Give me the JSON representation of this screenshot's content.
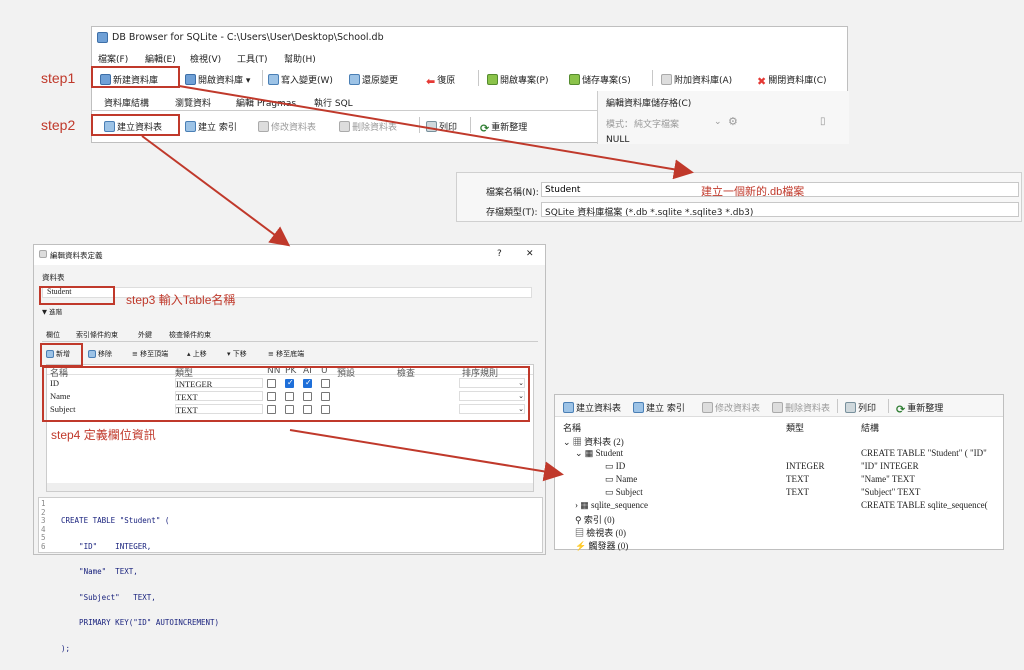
{
  "steps": {
    "step1": "step1",
    "step2": "step2",
    "step3": "step3 輸入Table名稱",
    "step4": "step4  定義欄位資訊"
  },
  "main_window": {
    "title": "DB Browser for SQLite - C:\\Users\\User\\Desktop\\School.db",
    "menu": [
      "檔案(F)",
      "編輯(E)",
      "檢視(V)",
      "工具(T)",
      "幫助(H)"
    ],
    "toolbar": [
      "新建資料庫",
      "開啟資料庫",
      "寫入變更(W)",
      "還原變更",
      "復原",
      "開啟專案(P)",
      "儲存專案(S)",
      "附加資料庫(A)",
      "關閉資料庫(C)"
    ],
    "tabs": [
      "資料庫結構",
      "瀏覽資料",
      "編輯 Pragmas",
      "執行 SQL"
    ],
    "subtoolbar": [
      "建立資料表",
      "建立 索引",
      "修改資料表",
      "刪除資料表",
      "列印",
      "重新整理"
    ],
    "right_panel": {
      "title": "編輯資料庫儲存格(C)",
      "mode_label": "模式：",
      "mode_value": "純文字檔案",
      "null_text": "NULL"
    }
  },
  "save_dialog": {
    "filename_label": "檔案名稱(N):",
    "filename_value": "Student",
    "filetype_label": "存檔類型(T):",
    "filetype_value": "SQLite 資料庫檔案 (*.db *.sqlite *.sqlite3 *.db3)",
    "annotation": "建立一個新的.db檔案"
  },
  "edit_dialog": {
    "title": "編輯資料表定義",
    "help": "?",
    "close": "✕",
    "table_label": "資料表",
    "table_name": "Student",
    "advanced": "▼ 進階",
    "tabs": [
      "欄位",
      "索引條件約束",
      "外鍵",
      "檢查條件約束"
    ],
    "field_toolbar": [
      "新增",
      "移除",
      "移至頂端",
      "上移",
      "下移",
      "移至底端"
    ],
    "columns": [
      "名稱",
      "類型",
      "NN",
      "PK",
      "AI",
      "U",
      "預設",
      "檢查",
      "排序規則"
    ],
    "fields": [
      {
        "name": "ID",
        "type": "INTEGER",
        "nn": false,
        "pk": true,
        "ai": true,
        "u": false
      },
      {
        "name": "Name",
        "type": "TEXT",
        "nn": false,
        "pk": false,
        "ai": false,
        "u": false
      },
      {
        "name": "Subject",
        "type": "TEXT",
        "nn": false,
        "pk": false,
        "ai": false,
        "u": false
      }
    ],
    "sql_lines": [
      "CREATE TABLE \"Student\" (",
      "    \"ID\"    INTEGER,",
      "    \"Name\"  TEXT,",
      "    \"Subject\"   TEXT,",
      "    PRIMARY KEY(\"ID\" AUTOINCREMENT)",
      ");"
    ],
    "line_numbers": [
      "1",
      "2",
      "3",
      "4",
      "5",
      "6"
    ]
  },
  "result_panel": {
    "toolbar": [
      "建立資料表",
      "建立 索引",
      "修改資料表",
      "刪除資料表",
      "列印",
      "重新整理"
    ],
    "headers": [
      "名稱",
      "類型",
      "結構"
    ],
    "rows": [
      {
        "name": "資料表 (2)",
        "type": "",
        "schema": ""
      },
      {
        "name": "Student",
        "type": "",
        "schema": "CREATE TABLE \"Student\" ( \"ID\""
      },
      {
        "name": "ID",
        "type": "INTEGER",
        "schema": "\"ID\" INTEGER"
      },
      {
        "name": "Name",
        "type": "TEXT",
        "schema": "\"Name\" TEXT"
      },
      {
        "name": "Subject",
        "type": "TEXT",
        "schema": "\"Subject\" TEXT"
      },
      {
        "name": "sqlite_sequence",
        "type": "",
        "schema": "CREATE TABLE sqlite_sequence("
      },
      {
        "name": "索引 (0)",
        "type": "",
        "schema": ""
      },
      {
        "name": "檢視表 (0)",
        "type": "",
        "schema": ""
      },
      {
        "name": "觸發器 (0)",
        "type": "",
        "schema": ""
      }
    ]
  }
}
